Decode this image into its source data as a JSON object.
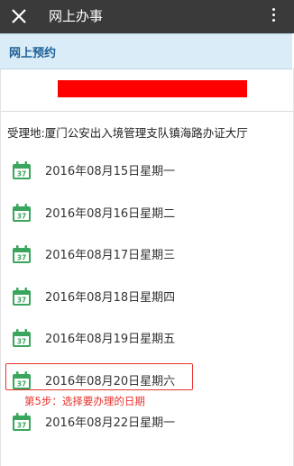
{
  "topbar": {
    "title": "网上办事"
  },
  "section": {
    "title": "网上预约"
  },
  "location": {
    "text": "受理地:厦门公安出入境管理支队镇海路办证大厅"
  },
  "calendar_icon_day": "37",
  "dates": [
    {
      "label": "2016年08月15日星期一"
    },
    {
      "label": "2016年08月16日星期二"
    },
    {
      "label": "2016年08月17日星期三"
    },
    {
      "label": "2016年08月18日星期四"
    },
    {
      "label": "2016年08月19日星期五"
    },
    {
      "label": "2016年08月20日星期六"
    },
    {
      "label": "2016年08月22日星期一"
    }
  ],
  "annotation": {
    "text": "第5步：选择要办理的日期"
  },
  "colors": {
    "topbar": "#3a3a3a",
    "section_bg": "#d9ecf7",
    "section_text": "#1f5f95",
    "calendar_green": "#3aa55d",
    "annotation_red": "#e8312d",
    "redaction": "#ff0000"
  },
  "icons": {
    "close": "close-icon",
    "more": "more-vertical-icon",
    "calendar": "calendar-icon"
  },
  "highlighted_date_index": 5
}
